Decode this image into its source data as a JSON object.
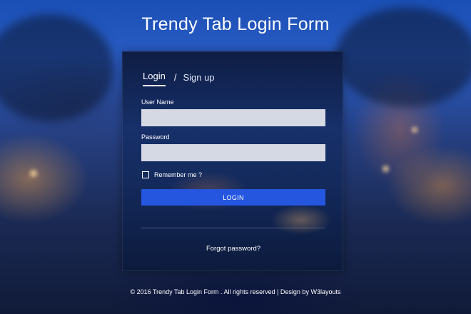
{
  "page": {
    "title": "Trendy Tab Login Form"
  },
  "tabs": [
    {
      "label": "Login",
      "active": true
    },
    {
      "label": "Sign up",
      "active": false
    }
  ],
  "tab_separator": "/",
  "form": {
    "username_label": "User Name",
    "username_value": "",
    "password_label": "Password",
    "password_value": "",
    "remember_label": "Remember me ?",
    "remember_checked": false,
    "login_button": "LOGIN",
    "forgot_link": "Forgot password?"
  },
  "footer": {
    "text": "© 2016 Trendy Tab Login Form . All rights reserved | Design by W3layouts"
  },
  "colors": {
    "button": "#2456e0",
    "card": "#142a5c",
    "background": "#1a4fb5"
  }
}
